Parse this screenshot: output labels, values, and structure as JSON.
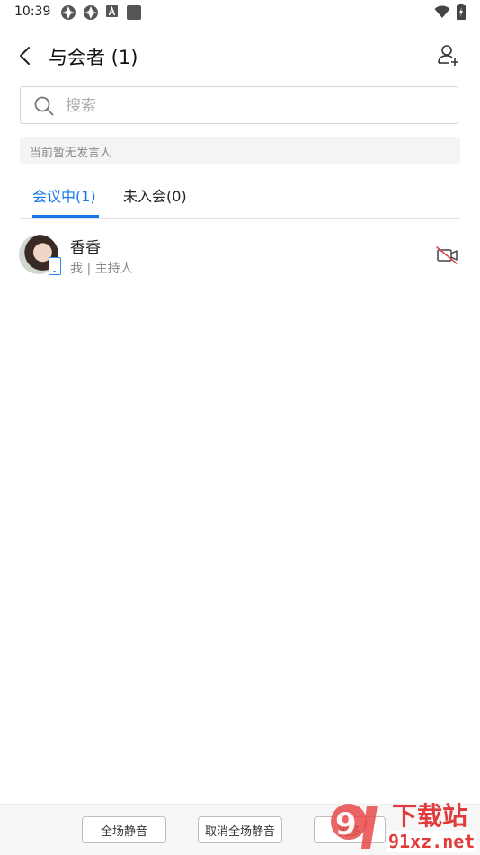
{
  "status_bar": {
    "time": "10:39"
  },
  "header": {
    "title": "与会者 (1)"
  },
  "search": {
    "placeholder": "搜索",
    "value": ""
  },
  "notice": {
    "text": "当前暂无发言人"
  },
  "tabs": [
    {
      "label": "会议中(1)",
      "active": true
    },
    {
      "label": "未入会(0)",
      "active": false
    }
  ],
  "participants": [
    {
      "name": "香香",
      "role": "我 | 主持人",
      "device": "phone-icon",
      "camera": "camera-off-icon"
    }
  ],
  "bottom_actions": {
    "mute_all": "全场静音",
    "unmute_all": "取消全场静音",
    "more": "更多"
  },
  "watermark": {
    "text_top": "下载站",
    "text_bottom": "91xz.net"
  },
  "colors": {
    "accent": "#1677e8",
    "camera_off": "#e0454a"
  }
}
